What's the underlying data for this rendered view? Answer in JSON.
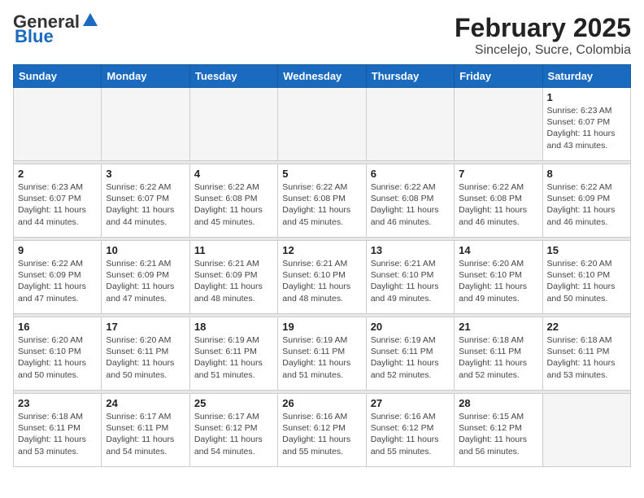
{
  "logo": {
    "line1": "General",
    "line2": "Blue"
  },
  "title": "February 2025",
  "subtitle": "Sincelejo, Sucre, Colombia",
  "weekdays": [
    "Sunday",
    "Monday",
    "Tuesday",
    "Wednesday",
    "Thursday",
    "Friday",
    "Saturday"
  ],
  "weeks": [
    [
      {
        "day": "",
        "info": ""
      },
      {
        "day": "",
        "info": ""
      },
      {
        "day": "",
        "info": ""
      },
      {
        "day": "",
        "info": ""
      },
      {
        "day": "",
        "info": ""
      },
      {
        "day": "",
        "info": ""
      },
      {
        "day": "1",
        "info": "Sunrise: 6:23 AM\nSunset: 6:07 PM\nDaylight: 11 hours\nand 43 minutes."
      }
    ],
    [
      {
        "day": "2",
        "info": "Sunrise: 6:23 AM\nSunset: 6:07 PM\nDaylight: 11 hours\nand 44 minutes."
      },
      {
        "day": "3",
        "info": "Sunrise: 6:22 AM\nSunset: 6:07 PM\nDaylight: 11 hours\nand 44 minutes."
      },
      {
        "day": "4",
        "info": "Sunrise: 6:22 AM\nSunset: 6:08 PM\nDaylight: 11 hours\nand 45 minutes."
      },
      {
        "day": "5",
        "info": "Sunrise: 6:22 AM\nSunset: 6:08 PM\nDaylight: 11 hours\nand 45 minutes."
      },
      {
        "day": "6",
        "info": "Sunrise: 6:22 AM\nSunset: 6:08 PM\nDaylight: 11 hours\nand 46 minutes."
      },
      {
        "day": "7",
        "info": "Sunrise: 6:22 AM\nSunset: 6:08 PM\nDaylight: 11 hours\nand 46 minutes."
      },
      {
        "day": "8",
        "info": "Sunrise: 6:22 AM\nSunset: 6:09 PM\nDaylight: 11 hours\nand 46 minutes."
      }
    ],
    [
      {
        "day": "9",
        "info": "Sunrise: 6:22 AM\nSunset: 6:09 PM\nDaylight: 11 hours\nand 47 minutes."
      },
      {
        "day": "10",
        "info": "Sunrise: 6:21 AM\nSunset: 6:09 PM\nDaylight: 11 hours\nand 47 minutes."
      },
      {
        "day": "11",
        "info": "Sunrise: 6:21 AM\nSunset: 6:09 PM\nDaylight: 11 hours\nand 48 minutes."
      },
      {
        "day": "12",
        "info": "Sunrise: 6:21 AM\nSunset: 6:10 PM\nDaylight: 11 hours\nand 48 minutes."
      },
      {
        "day": "13",
        "info": "Sunrise: 6:21 AM\nSunset: 6:10 PM\nDaylight: 11 hours\nand 49 minutes."
      },
      {
        "day": "14",
        "info": "Sunrise: 6:20 AM\nSunset: 6:10 PM\nDaylight: 11 hours\nand 49 minutes."
      },
      {
        "day": "15",
        "info": "Sunrise: 6:20 AM\nSunset: 6:10 PM\nDaylight: 11 hours\nand 50 minutes."
      }
    ],
    [
      {
        "day": "16",
        "info": "Sunrise: 6:20 AM\nSunset: 6:10 PM\nDaylight: 11 hours\nand 50 minutes."
      },
      {
        "day": "17",
        "info": "Sunrise: 6:20 AM\nSunset: 6:11 PM\nDaylight: 11 hours\nand 50 minutes."
      },
      {
        "day": "18",
        "info": "Sunrise: 6:19 AM\nSunset: 6:11 PM\nDaylight: 11 hours\nand 51 minutes."
      },
      {
        "day": "19",
        "info": "Sunrise: 6:19 AM\nSunset: 6:11 PM\nDaylight: 11 hours\nand 51 minutes."
      },
      {
        "day": "20",
        "info": "Sunrise: 6:19 AM\nSunset: 6:11 PM\nDaylight: 11 hours\nand 52 minutes."
      },
      {
        "day": "21",
        "info": "Sunrise: 6:18 AM\nSunset: 6:11 PM\nDaylight: 11 hours\nand 52 minutes."
      },
      {
        "day": "22",
        "info": "Sunrise: 6:18 AM\nSunset: 6:11 PM\nDaylight: 11 hours\nand 53 minutes."
      }
    ],
    [
      {
        "day": "23",
        "info": "Sunrise: 6:18 AM\nSunset: 6:11 PM\nDaylight: 11 hours\nand 53 minutes."
      },
      {
        "day": "24",
        "info": "Sunrise: 6:17 AM\nSunset: 6:11 PM\nDaylight: 11 hours\nand 54 minutes."
      },
      {
        "day": "25",
        "info": "Sunrise: 6:17 AM\nSunset: 6:12 PM\nDaylight: 11 hours\nand 54 minutes."
      },
      {
        "day": "26",
        "info": "Sunrise: 6:16 AM\nSunset: 6:12 PM\nDaylight: 11 hours\nand 55 minutes."
      },
      {
        "day": "27",
        "info": "Sunrise: 6:16 AM\nSunset: 6:12 PM\nDaylight: 11 hours\nand 55 minutes."
      },
      {
        "day": "28",
        "info": "Sunrise: 6:15 AM\nSunset: 6:12 PM\nDaylight: 11 hours\nand 56 minutes."
      },
      {
        "day": "",
        "info": ""
      }
    ]
  ]
}
